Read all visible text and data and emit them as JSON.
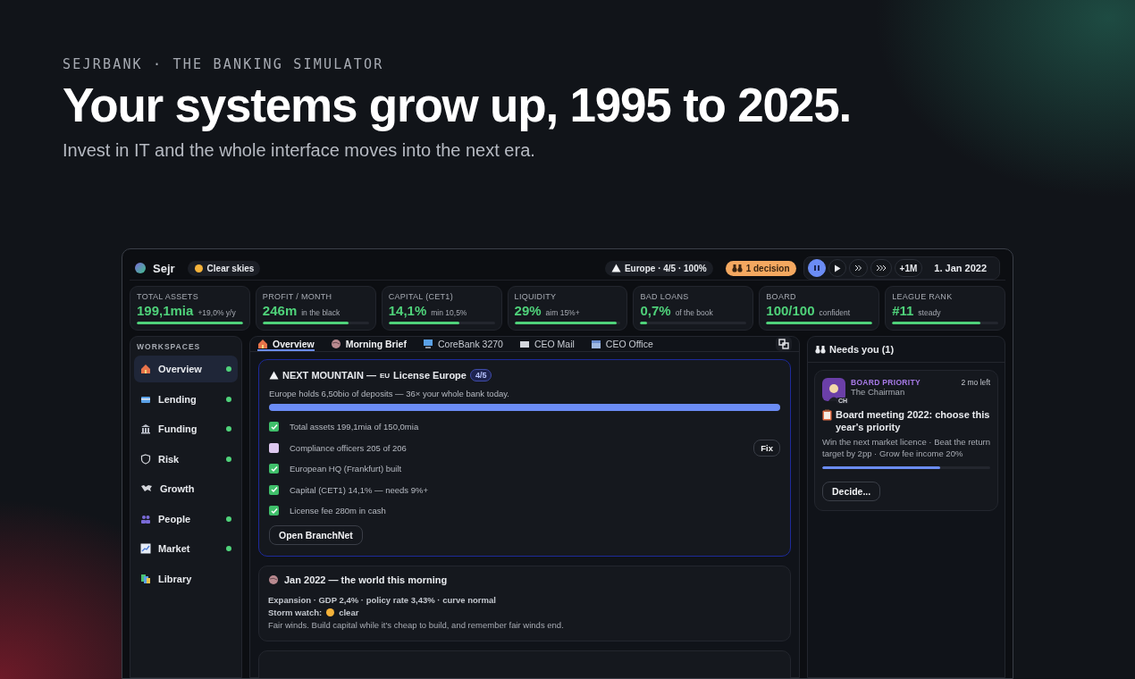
{
  "hero": {
    "eyebrow": "SEJRBANK · THE BANKING SIMULATOR",
    "headline": "Your systems grow up, 1995 to 2025.",
    "subtitle": "Invest in IT and the whole interface moves into the next era."
  },
  "topbar": {
    "app_name": "Sejr",
    "weather": "Clear skies",
    "mountain": "Europe · 4/5 · 100%",
    "decisions": "1 decision",
    "speed": [
      {
        "kind": "pause",
        "selected": true
      },
      {
        "kind": "play",
        "selected": false
      },
      {
        "kind": "fast",
        "selected": false
      },
      {
        "kind": "faster",
        "selected": false
      },
      {
        "kind": "text",
        "label": "+1M",
        "selected": false
      }
    ],
    "date": "1. Jan 2022"
  },
  "stats": [
    {
      "label": "TOTAL ASSETS",
      "value": "199,1mia",
      "note": "+19,0% y/y",
      "level": 1.0
    },
    {
      "label": "PROFIT / MONTH",
      "value": "246m",
      "note": "in the black",
      "level": 0.81
    },
    {
      "label": "CAPITAL (CET1)",
      "value": "14,1%",
      "note": "min 10,5%",
      "level": 0.67
    },
    {
      "label": "LIQUIDITY",
      "value": "29%",
      "note": "aim 15%+",
      "level": 0.96
    },
    {
      "label": "BAD LOANS",
      "value": "0,7%",
      "note": "of the book",
      "level": 0.06
    },
    {
      "label": "BOARD",
      "value": "100/100",
      "note": "confident",
      "level": 1.0
    },
    {
      "label": "LEAGUE RANK",
      "value": "#11",
      "note": "steady",
      "level": 0.83
    }
  ],
  "sidebar": {
    "title": "WORKSPACES",
    "items": [
      {
        "label": "Overview",
        "selected": true,
        "alert": true
      },
      {
        "label": "Lending",
        "selected": false,
        "alert": true
      },
      {
        "label": "Funding",
        "selected": false,
        "alert": true
      },
      {
        "label": "Risk",
        "selected": false,
        "alert": true
      },
      {
        "label": "Growth",
        "selected": false,
        "alert": false
      },
      {
        "label": "People",
        "selected": false,
        "alert": true
      },
      {
        "label": "Market",
        "selected": false,
        "alert": true
      },
      {
        "label": "Library",
        "selected": false,
        "alert": false
      }
    ]
  },
  "tabs": [
    {
      "label": "Overview",
      "selected": true,
      "pinned": true
    },
    {
      "label": "Morning Brief",
      "selected": false,
      "pinned": true
    },
    {
      "label": "CoreBank 3270",
      "selected": false,
      "pinned": false
    },
    {
      "label": "CEO Mail",
      "selected": false,
      "pinned": false
    },
    {
      "label": "CEO Office",
      "selected": false,
      "pinned": false
    }
  ],
  "mountain": {
    "title": "NEXT MOUNTAIN —",
    "region_code": "EU",
    "name": "License Europe",
    "step": "4/5",
    "description": "Europe holds 6,50bio of deposits — 36× your whole bank today.",
    "level": 1.0,
    "checklist": [
      {
        "label": "Total assets 199,1mia of 150,0mia",
        "checked": true
      },
      {
        "label": "Compliance officers 205 of 206",
        "checked": false,
        "action": "Fix"
      },
      {
        "label": "European HQ (Frankfurt) built",
        "checked": true
      },
      {
        "label": "Capital (CET1) 14,1% — needs 9%+",
        "checked": true
      },
      {
        "label": "License fee 280m in cash",
        "checked": true
      }
    ],
    "button": "Open BranchNet"
  },
  "brief": {
    "title": "Jan 2022 — the world this morning",
    "economy": "Expansion · GDP 2,4% · policy rate 3,43% · curve normal",
    "storm_label": "Storm watch:",
    "storm_value": "clear",
    "note": "Fair winds. Build capital while it's cheap to build, and remember fair winds end."
  },
  "needs": {
    "title": "Needs you (1)",
    "cards": [
      {
        "category": "BOARD PRIORITY",
        "from": "The Chairman",
        "avatar_badge": "CH",
        "due": "2 mo left",
        "title": "Board meeting 2022: choose this year's priority",
        "description": "Win the next market licence · Beat the return target by 2pp · Grow fee income 20%",
        "level": 0.7,
        "button": "Decide..."
      }
    ]
  }
}
